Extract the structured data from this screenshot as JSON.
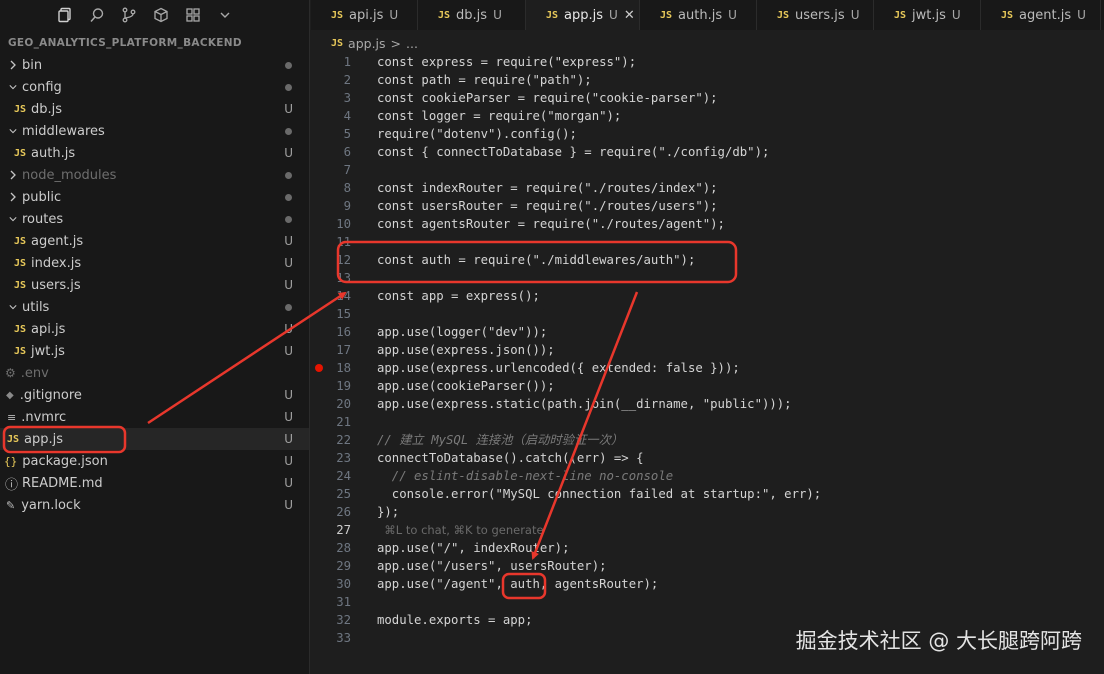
{
  "explorer": {
    "project_title": "GEO_ANALYTICS_PLATFORM_BACKEND",
    "toolbar_icons": [
      "files-icon",
      "search-icon",
      "source-control-icon",
      "box-icon",
      "extensions-icon",
      "chevron-down-icon"
    ],
    "items": [
      {
        "label": "bin",
        "kind": "folder",
        "status": "dot"
      },
      {
        "label": "config",
        "kind": "folder",
        "status": "dot"
      },
      {
        "label": "db.js",
        "kind": "js",
        "status": "U"
      },
      {
        "label": "middlewares",
        "kind": "folder",
        "status": "dot"
      },
      {
        "label": "auth.js",
        "kind": "js",
        "status": "U"
      },
      {
        "label": "node_modules",
        "kind": "folder-dim",
        "status": "dot"
      },
      {
        "label": "public",
        "kind": "folder",
        "status": "dot"
      },
      {
        "label": "routes",
        "kind": "folder",
        "status": "dot"
      },
      {
        "label": "agent.js",
        "kind": "js",
        "status": "U"
      },
      {
        "label": "index.js",
        "kind": "js",
        "status": "U"
      },
      {
        "label": "users.js",
        "kind": "js",
        "status": "U"
      },
      {
        "label": "utils",
        "kind": "folder",
        "status": "dot"
      },
      {
        "label": "api.js",
        "kind": "js",
        "status": "U"
      },
      {
        "label": "jwt.js",
        "kind": "js",
        "status": "U"
      },
      {
        "label": ".env",
        "kind": "gear-dim",
        "status": ""
      },
      {
        "label": ".gitignore",
        "kind": "git",
        "status": "U"
      },
      {
        "label": ".nvmrc",
        "kind": "lines",
        "status": "U"
      },
      {
        "label": "app.js",
        "kind": "js",
        "status": "U"
      },
      {
        "label": "package.json",
        "kind": "json",
        "status": "U"
      },
      {
        "label": "README.md",
        "kind": "info",
        "status": "U"
      },
      {
        "label": "yarn.lock",
        "kind": "yarn",
        "status": "U"
      }
    ]
  },
  "tabs": [
    {
      "label": "api.js",
      "status": "U",
      "active": false
    },
    {
      "label": "db.js",
      "status": "U",
      "active": false
    },
    {
      "label": "app.js",
      "status": "U",
      "active": true
    },
    {
      "label": "auth.js",
      "status": "U",
      "active": false
    },
    {
      "label": "users.js",
      "status": "U",
      "active": false
    },
    {
      "label": "jwt.js",
      "status": "U",
      "active": false
    },
    {
      "label": "agent.js",
      "status": "U",
      "active": false
    }
  ],
  "breadcrumb": {
    "file": "app.js",
    "sep": ">",
    "more": "..."
  },
  "current_line": "27",
  "breakpoint_line": "18",
  "code_lines": [
    {
      "n": "1",
      "t": "const express = require(\"express\");"
    },
    {
      "n": "2",
      "t": "const path = require(\"path\");"
    },
    {
      "n": "3",
      "t": "const cookieParser = require(\"cookie-parser\");"
    },
    {
      "n": "4",
      "t": "const logger = require(\"morgan\");"
    },
    {
      "n": "5",
      "t": "require(\"dotenv\").config();"
    },
    {
      "n": "6",
      "t": "const { connectToDatabase } = require(\"./config/db\");"
    },
    {
      "n": "7",
      "t": ""
    },
    {
      "n": "8",
      "t": "const indexRouter = require(\"./routes/index\");"
    },
    {
      "n": "9",
      "t": "const usersRouter = require(\"./routes/users\");"
    },
    {
      "n": "10",
      "t": "const agentsRouter = require(\"./routes/agent\");"
    },
    {
      "n": "11",
      "t": ""
    },
    {
      "n": "12",
      "t": "const auth = require(\"./middlewares/auth\");"
    },
    {
      "n": "13",
      "t": ""
    },
    {
      "n": "14",
      "t": "const app = express();"
    },
    {
      "n": "15",
      "t": ""
    },
    {
      "n": "16",
      "t": "app.use(logger(\"dev\"));"
    },
    {
      "n": "17",
      "t": "app.use(express.json());"
    },
    {
      "n": "18",
      "t": "app.use(express.urlencoded({ extended: false }));"
    },
    {
      "n": "19",
      "t": "app.use(cookieParser());"
    },
    {
      "n": "20",
      "t": "app.use(express.static(path.join(__dirname, \"public\")));"
    },
    {
      "n": "21",
      "t": ""
    },
    {
      "n": "22",
      "t": "// 建立 MySQL 连接池（启动时验证一次）"
    },
    {
      "n": "23",
      "t": "connectToDatabase().catch((err) => {"
    },
    {
      "n": "24",
      "t": "  // eslint-disable-next-line no-console"
    },
    {
      "n": "25",
      "t": "  console.error(\"MySQL connection failed at startup:\", err);"
    },
    {
      "n": "26",
      "t": "});"
    },
    {
      "n": "27",
      "t": "  ⌘L to chat, ⌘K to generate"
    },
    {
      "n": "28",
      "t": "app.use(\"/\", indexRouter);"
    },
    {
      "n": "29",
      "t": "app.use(\"/users\", usersRouter);"
    },
    {
      "n": "30",
      "t": "app.use(\"/agent\", auth, agentsRouter);"
    },
    {
      "n": "31",
      "t": ""
    },
    {
      "n": "32",
      "t": "module.exports = app;"
    },
    {
      "n": "33",
      "t": ""
    }
  ],
  "colors": {
    "annotation": "#e8372c",
    "breakpoint": "#e51400",
    "js_icon": "#e8c95a"
  },
  "watermark": "掘金技术社区 @ 大长腿跨阿跨"
}
